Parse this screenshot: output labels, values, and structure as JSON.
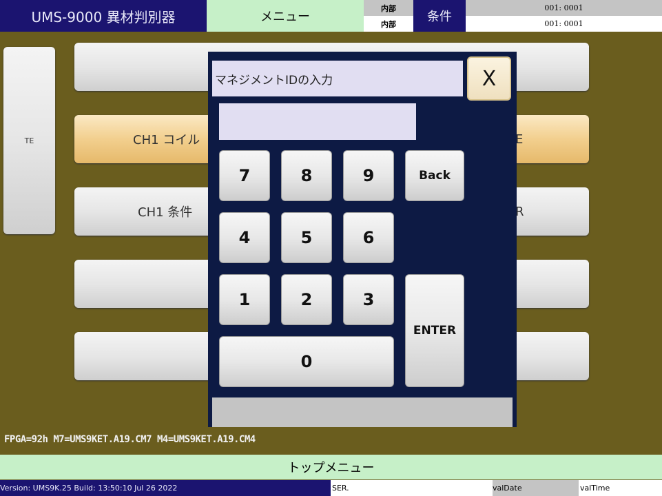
{
  "header": {
    "title": "UMS-9000 異材判別器",
    "menu": "メニュー",
    "source_top": "内部",
    "source_bottom": "内部",
    "condition": "条件",
    "value_top": "001: 0001",
    "value_bottom": "001: 0001"
  },
  "side_button": {
    "label": "TE"
  },
  "menu_buttons": [
    {
      "left": "",
      "right": ""
    },
    {
      "left": "CH1 コイル",
      "right": "E"
    },
    {
      "left": "CH1 条件",
      "right": "R"
    },
    {
      "left": "",
      "right": ""
    },
    {
      "left": "",
      "right": ""
    }
  ],
  "dialog": {
    "title": "マネジメントIDの入力",
    "close": "X",
    "input_value": "",
    "keys": {
      "k7": "7",
      "k8": "8",
      "k9": "9",
      "back": "Back",
      "k4": "4",
      "k5": "5",
      "k6": "6",
      "k1": "1",
      "k2": "2",
      "k3": "3",
      "enter": "ENTER",
      "k0": "0"
    },
    "status": ""
  },
  "fpga": "FPGA=92h M7=UMS9KET.A19.CM7 M4=UMS9KET.A19.CM4",
  "top_menu": "トップメニュー",
  "footer": {
    "version": "Version: UMS9K.25 Build: 13:50:10 Jul 26 2022",
    "user": "SER.",
    "date": "valDate",
    "time": "valTime"
  }
}
